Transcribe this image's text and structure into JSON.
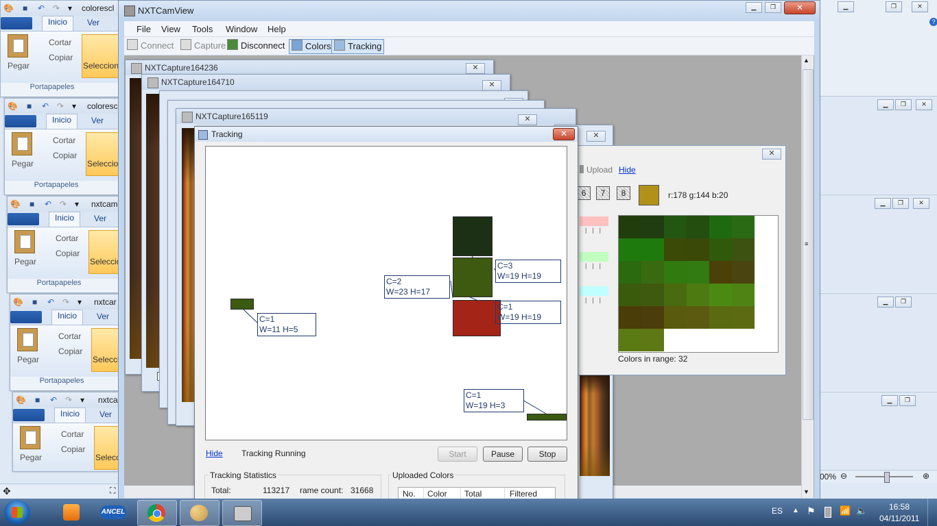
{
  "paint_windows": [
    {
      "title": "colorescl",
      "tab_home": "Inicio",
      "tab_view": "Ver",
      "paste": "Pegar",
      "cut": "Cortar",
      "copy": "Copiar",
      "select": "Seleccion",
      "group": "Portapapeles"
    },
    {
      "title": "coloresc",
      "tab_home": "Inicio",
      "tab_view": "Ver",
      "paste": "Pegar",
      "cut": "Cortar",
      "copy": "Copiar",
      "select": "Seleccion",
      "group": "Portapapeles"
    },
    {
      "title": "nxtcam",
      "tab_home": "Inicio",
      "tab_view": "Ver",
      "paste": "Pegar",
      "cut": "Cortar",
      "copy": "Copiar",
      "select": "Seleccio",
      "group": "Portapapeles"
    },
    {
      "title": "nxtcar",
      "tab_home": "Inicio",
      "tab_view": "Ver",
      "paste": "Pegar",
      "cut": "Cortar",
      "copy": "Copiar",
      "select": "Seleccio",
      "group": "Portapapeles"
    },
    {
      "title": "nxtca",
      "tab_home": "Inicio",
      "tab_view": "Ver",
      "paste": "Pegar",
      "cut": "Cortar",
      "copy": "Copiar",
      "select": "Seleccio",
      "group": ""
    }
  ],
  "main": {
    "title": "NXTCamView",
    "menu": [
      "File",
      "View",
      "Tools",
      "Window",
      "Help"
    ],
    "toolbar": {
      "connect": "Connect",
      "capture": "Capture",
      "disconnect": "Disconnect",
      "colors": "Colors",
      "tracking": "Tracking"
    }
  },
  "captures": [
    "NXTCapture164236",
    "NXTCapture164710",
    "NXTCapture165119"
  ],
  "capture_checkbox_label": "H",
  "tracking": {
    "title": "Tracking",
    "blobs": [
      {
        "label1": "C=1",
        "label2": "W=11 H=5",
        "color": "#3b5a12"
      },
      {
        "label1": "C=2",
        "label2": "W=23 H=17",
        "color": "#1c3016"
      },
      {
        "label1": "C=3",
        "label2": "W=19 H=19",
        "color": "#3d5a10"
      },
      {
        "label1": "C=1",
        "label2": "W=19 H=19",
        "color": "#a42418"
      },
      {
        "label1": "C=1",
        "label2": "W=19 H=3",
        "color": "#3a5a12"
      }
    ],
    "hide_link": "Hide",
    "status": "Tracking Running",
    "start": "Start",
    "pause": "Pause",
    "stop": "Stop",
    "stats_header": "Tracking Statistics",
    "total_label": "Total:",
    "total_value": "113217",
    "frame_count_label": "rame count:",
    "frame_count_value": "31668",
    "uploaded_header": "Uploaded Colors",
    "table_headers": [
      "No.",
      "Color",
      "Total",
      "Filtered"
    ]
  },
  "colors": {
    "upload": "Upload",
    "hide": "Hide",
    "slots": [
      "6",
      "7",
      "8"
    ],
    "selected_color": "#b2901a",
    "rgb_text": "r:178 g:144 b:20",
    "range_text": "Colors in range: 32",
    "range_swatches": [
      "#ffc0c0",
      "#c0ffc0",
      "#c0ffff"
    ],
    "grid_colors": [
      [
        "#213d0c",
        "#1f3d10",
        "#235711",
        "#244d10",
        "#1f6a10",
        "#2a6a15"
      ],
      [
        "#1f7a0e",
        "#1f7a0e",
        "#3c4a08",
        "#3a4808",
        "#2f5a0c",
        "#3d5210"
      ],
      [
        "#2c6a10",
        "#3a6a10",
        "#307a10",
        "#327a12",
        "#4a4008",
        "#4a4410"
      ],
      [
        "#3a5a0c",
        "#3e5a0f",
        "#4a6a10",
        "#4e7a12",
        "#4a8a12",
        "#4e8414"
      ],
      [
        "#4a3d08",
        "#4c3d0c",
        "#5a5a0c",
        "#5c5a10",
        "#5a6a10",
        "#5c6a12"
      ],
      [
        "#5a7a14",
        "#5e7816",
        "",
        "",
        "",
        ""
      ]
    ]
  },
  "paint_status": {
    "zoom": "00%"
  },
  "taskbar": {
    "lang": "ES",
    "time": "16:58",
    "date": "04/11/2011"
  }
}
